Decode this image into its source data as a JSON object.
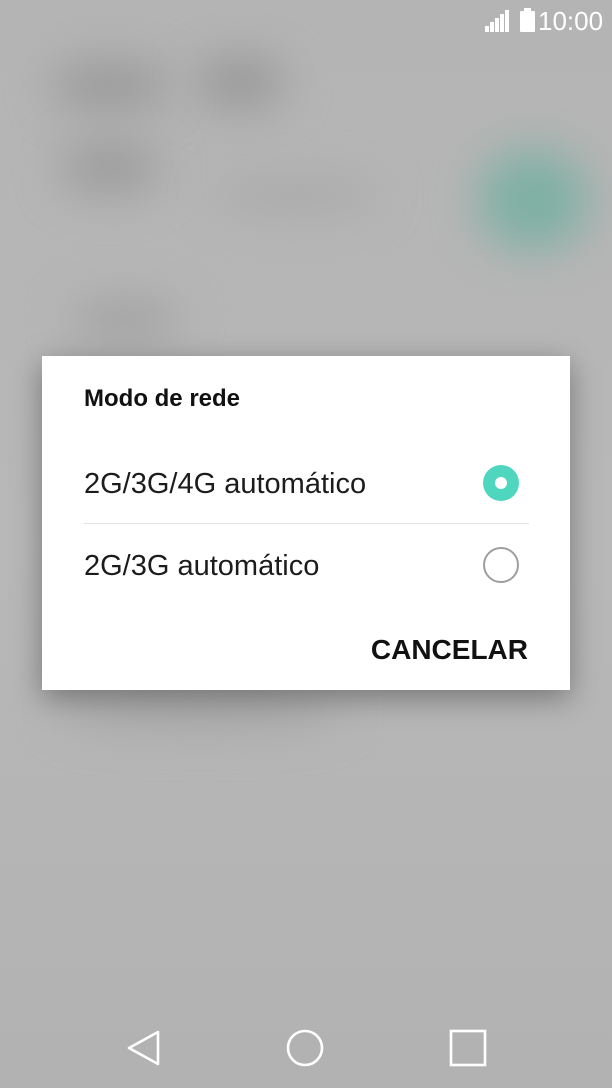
{
  "status_bar": {
    "time": "10:00",
    "signal_icon": "signal-icon",
    "battery_icon": "battery-icon"
  },
  "dialog": {
    "title": "Modo de rede",
    "options": [
      {
        "label": "2G/3G/4G automático",
        "selected": true
      },
      {
        "label": "2G/3G automático",
        "selected": false
      }
    ],
    "cancel_label": "CANCELAR"
  },
  "nav_bar": {
    "back_icon": "back-triangle-icon",
    "home_icon": "home-circle-icon",
    "recents_icon": "recents-square-icon"
  },
  "colors": {
    "accent": "#4fd6bf",
    "scrim": "#b9b9b9",
    "dialog_bg": "#ffffff"
  }
}
